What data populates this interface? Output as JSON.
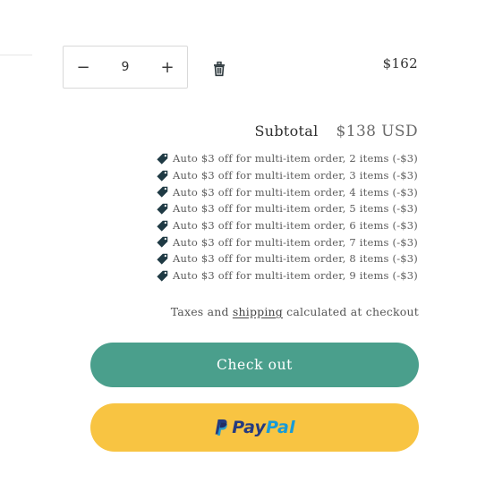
{
  "cart_item": {
    "quantity": "9",
    "decrease_label": "−",
    "increase_label": "+",
    "price": "$162",
    "remove_icon": "trash-icon"
  },
  "summary": {
    "subtotal_label": "Subtotal",
    "subtotal_value": "$138 USD",
    "discounts": [
      "Auto $3 off for multi-item order, 2 items (-$3)",
      "Auto $3 off for multi-item order, 3 items (-$3)",
      "Auto $3 off for multi-item order, 4 items (-$3)",
      "Auto $3 off for multi-item order, 5 items (-$3)",
      "Auto $3 off for multi-item order, 6 items (-$3)",
      "Auto $3 off for multi-item order, 7 items (-$3)",
      "Auto $3 off for multi-item order, 8 items (-$3)",
      "Auto $3 off for multi-item order, 9 items (-$3)"
    ],
    "discount_icon": "tag-icon",
    "tax_note_before": "Taxes and ",
    "tax_note_link": "shipping",
    "tax_note_after": " calculated at checkout"
  },
  "actions": {
    "checkout_label": "Check out",
    "paypal_pay": "Pay",
    "paypal_pal": "Pal"
  },
  "colors": {
    "checkout_bg": "#4a9f8c",
    "paypal_bg": "#f8c442",
    "paypal_dark_blue": "#253b80",
    "paypal_light_blue": "#179bd7",
    "tag_icon": "#1f3a44"
  }
}
